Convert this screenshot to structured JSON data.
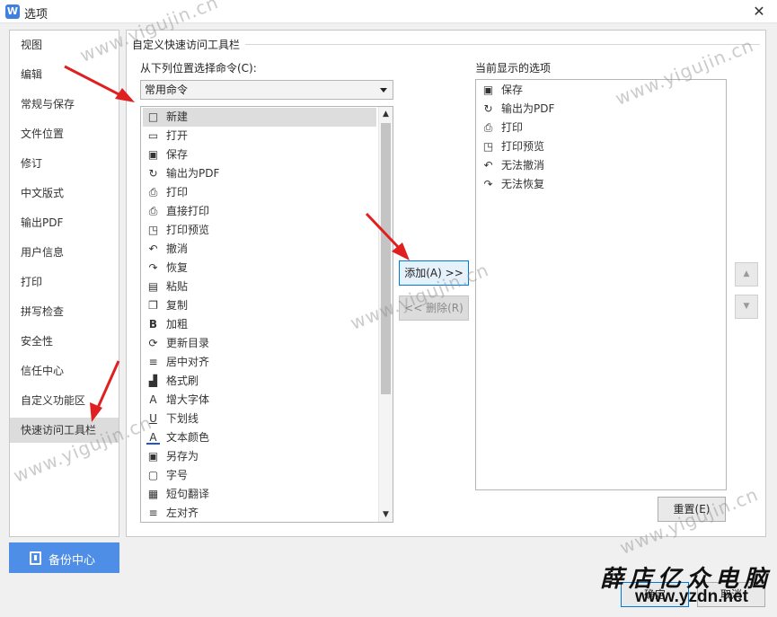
{
  "window": {
    "title": "选项",
    "app_icon": "W"
  },
  "nav": {
    "items": [
      {
        "label": "视图"
      },
      {
        "label": "编辑"
      },
      {
        "label": "常规与保存"
      },
      {
        "label": "文件位置"
      },
      {
        "label": "修订"
      },
      {
        "label": "中文版式"
      },
      {
        "label": "输出PDF"
      },
      {
        "label": "用户信息"
      },
      {
        "label": "打印"
      },
      {
        "label": "拼写检查"
      },
      {
        "label": "安全性"
      },
      {
        "label": "信任中心"
      },
      {
        "label": "自定义功能区"
      },
      {
        "label": "快速访问工具栏"
      }
    ],
    "selected": "快速访问工具栏",
    "backup_label": "备份中心"
  },
  "panel": {
    "section_title": "自定义快速访问工具栏",
    "choose_label": "从下列位置选择命令(C):",
    "dropdown_value": "常用命令",
    "commands": [
      {
        "label": "新建",
        "icon": "□"
      },
      {
        "label": "打开",
        "icon": "▭"
      },
      {
        "label": "保存",
        "icon": "▣"
      },
      {
        "label": "输出为PDF",
        "icon": "↻"
      },
      {
        "label": "打印",
        "icon": "⎙"
      },
      {
        "label": "直接打印",
        "icon": "⎙"
      },
      {
        "label": "打印预览",
        "icon": "◳"
      },
      {
        "label": "撤消",
        "icon": "↶"
      },
      {
        "label": "恢复",
        "icon": "↷"
      },
      {
        "label": "粘贴",
        "icon": "▤"
      },
      {
        "label": "复制",
        "icon": "❐"
      },
      {
        "label": "加粗",
        "icon": "B"
      },
      {
        "label": "更新目录",
        "icon": "⟳"
      },
      {
        "label": "居中对齐",
        "icon": "≡"
      },
      {
        "label": "格式刷",
        "icon": "▟"
      },
      {
        "label": "增大字体",
        "icon": "A"
      },
      {
        "label": "下划线",
        "icon": "U"
      },
      {
        "label": "文本颜色",
        "icon": "A"
      },
      {
        "label": "另存为",
        "icon": "▣"
      },
      {
        "label": "字号",
        "icon": "▢"
      },
      {
        "label": "短句翻译",
        "icon": "▦"
      },
      {
        "label": "左对齐",
        "icon": "≡"
      }
    ],
    "selected_command": "新建",
    "current_label": "当前显示的选项",
    "current_items": [
      {
        "label": "保存",
        "icon": "▣"
      },
      {
        "label": "输出为PDF",
        "icon": "↻"
      },
      {
        "label": "打印",
        "icon": "⎙"
      },
      {
        "label": "打印预览",
        "icon": "◳"
      },
      {
        "label": "无法撤消",
        "icon": "↶"
      },
      {
        "label": "无法恢复",
        "icon": "↷"
      }
    ],
    "add_label": "添加(A) >>",
    "remove_label": "<< 删除(R)",
    "reset_label": "重置(E)"
  },
  "footer": {
    "ok_label": "确定",
    "cancel_label": "取消"
  },
  "watermarks": {
    "site": "www.yigujin.cn",
    "brand": "薛店亿众电脑",
    "url": "www.yzdn.net"
  },
  "colors": {
    "accent": "#4f8ee6",
    "annotation_arrow": "#e02020"
  }
}
